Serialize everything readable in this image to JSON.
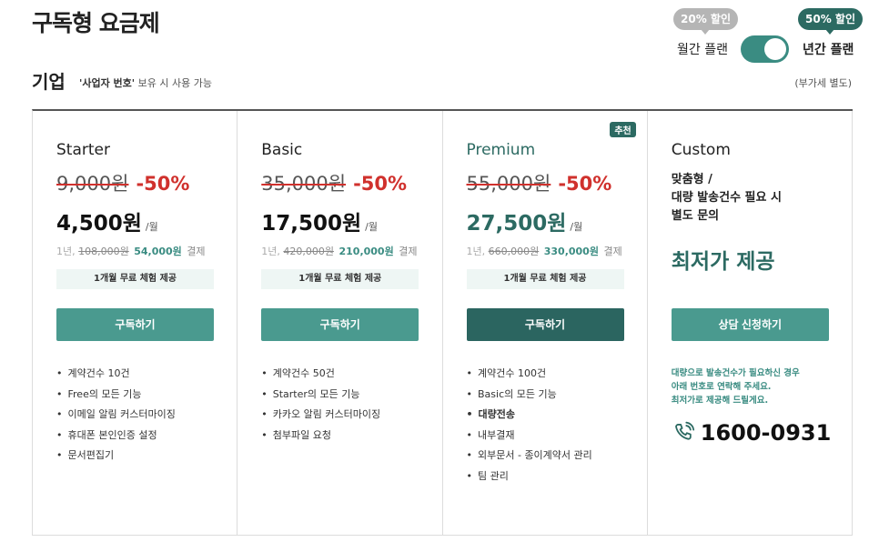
{
  "header": {
    "title": "구독형 요금제",
    "monthly_badge": "20% 할인",
    "yearly_badge": "50% 할인",
    "monthly_label": "월간 플랜",
    "yearly_label": "년간 플랜",
    "toggle_state": "yearly"
  },
  "section": {
    "title": "기업",
    "note_bold": "'사업자 번호'",
    "note_rest": " 보유 시 사용 가능",
    "vat_note": "(부가세 별도)"
  },
  "plans": [
    {
      "name": "Starter",
      "orig_price": "9,000원",
      "discount": "-50%",
      "price": "4,500원",
      "per": "/월",
      "yearly_prefix": "1년,",
      "yearly_orig": "108,000원",
      "yearly_price": "54,000원",
      "yearly_suffix": "결제",
      "trial": "1개월 무료 체험 제공",
      "button": "구독하기",
      "features": [
        "계약건수 10건",
        "Free의 모든 기능",
        "이메일 알림 커스터마이징",
        "휴대폰 본인인증 설정",
        "문서편집기"
      ]
    },
    {
      "name": "Basic",
      "orig_price": "35,000원",
      "discount": "-50%",
      "price": "17,500원",
      "per": "/월",
      "yearly_prefix": "1년,",
      "yearly_orig": "420,000원",
      "yearly_price": "210,000원",
      "yearly_suffix": "결제",
      "trial": "1개월 무료 체험 제공",
      "button": "구독하기",
      "features": [
        "계약건수 50건",
        "Starter의 모든 기능",
        "카카오 알림 커스터마이징",
        "첨부파일 요청"
      ]
    },
    {
      "name": "Premium",
      "badge": "추천",
      "orig_price": "55,000원",
      "discount": "-50%",
      "price": "27,500원",
      "per": "/월",
      "yearly_prefix": "1년,",
      "yearly_orig": "660,000원",
      "yearly_price": "330,000원",
      "yearly_suffix": "결제",
      "trial": "1개월 무료 체험 제공",
      "button": "구독하기",
      "features": [
        "계약건수 100건",
        "Basic의 모든 기능",
        "대량전송",
        "내부결재",
        "외부문서 - 종이계약서 관리",
        "팀 관리"
      ]
    },
    {
      "name": "Custom",
      "desc_line1": "맞춤형 /",
      "desc_line2": "대량 발송건수 필요 시",
      "desc_line3": "별도 문의",
      "cta": "최저가 제공",
      "button": "상담 신청하기",
      "note_line1": "대량으로 발송건수가 필요하신 경우",
      "note_line2": "아래 번호로 연락해 주세요.",
      "note_line3": "최저가로 제공해 드릴게요.",
      "phone": "1600-0931"
    }
  ],
  "colors": {
    "accent": "#4a9a8f",
    "accent_dark": "#2c6a62",
    "discount_red": "#d0312d",
    "badge_gray": "#b5b5b5"
  },
  "icons": {
    "phone": "phone-icon"
  }
}
